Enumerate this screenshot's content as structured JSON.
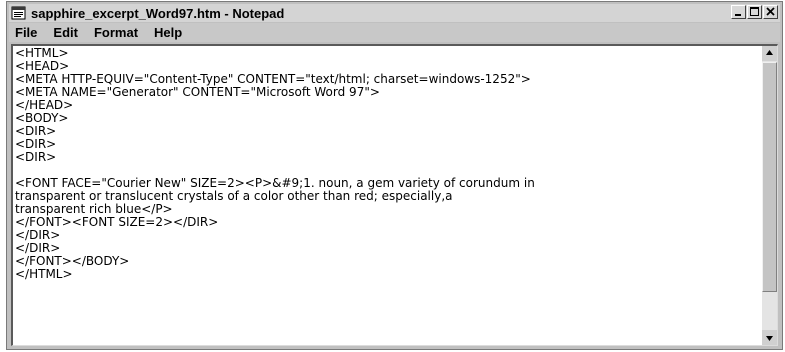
{
  "window": {
    "title": "sapphire_excerpt_Word97.htm - Notepad",
    "icon": "notepad-icon"
  },
  "menu": {
    "items": [
      "File",
      "Edit",
      "Format",
      "Help"
    ]
  },
  "editor": {
    "lines": [
      "<HTML>",
      "<HEAD>",
      "<META HTTP-EQUIV=\"Content-Type\" CONTENT=\"text/html; charset=windows-1252\">",
      "<META NAME=\"Generator\" CONTENT=\"Microsoft Word 97\">",
      "</HEAD>",
      "<BODY>",
      "<DIR>",
      "<DIR>",
      "<DIR>",
      "",
      "<FONT FACE=\"Courier New\" SIZE=2><P>&#9;1. noun, a gem variety of corundum in",
      "transparent or translucent crystals of a color other than red; especially,a",
      "transparent rich blue</P>",
      "</FONT><FONT SIZE=2></DIR>",
      "</DIR>",
      "</DIR>",
      "</FONT></BODY>",
      "</HTML>"
    ]
  },
  "scrollbar": {
    "position": 0
  }
}
